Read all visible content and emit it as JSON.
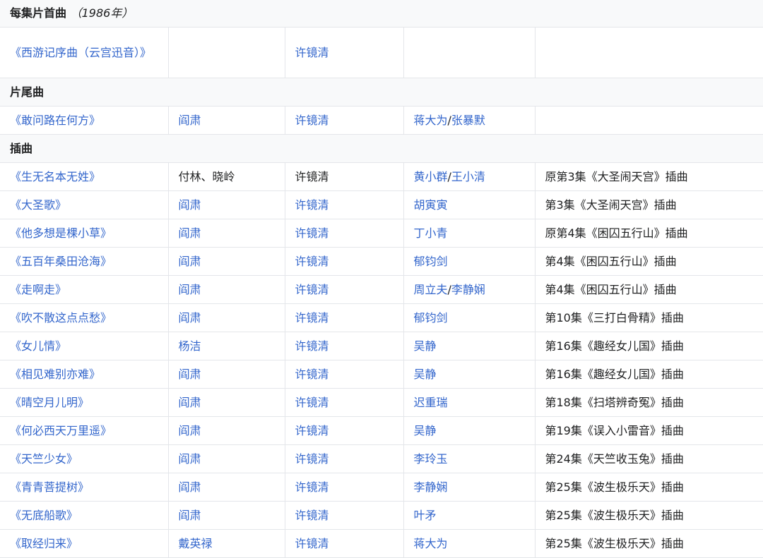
{
  "sections": {
    "opening": {
      "label": "每集片首曲",
      "year": "（1986年）"
    },
    "ending": {
      "label": "片尾曲"
    },
    "insert": {
      "label": "插曲"
    }
  },
  "opening_row": {
    "title": "《西游记序曲（云宫迅音）》",
    "composer": "许镜清"
  },
  "ending_row": {
    "title": "《敢问路在何方》",
    "lyricist": "阎肃",
    "composer": "许镜清",
    "singer_a": "蒋大为",
    "singer_b": "张暴默"
  },
  "rows": [
    {
      "title": "《生无名本无姓》",
      "lyricist": "付林、晓岭",
      "composer": "许镜清",
      "singer_a": "黄小群",
      "singer_b": "王小清",
      "note": "原第3集《大圣闹天宫》插曲"
    },
    {
      "title": "《大圣歌》",
      "lyricist": "阎肃",
      "composer": "许镜清",
      "singer_a": "胡寅寅",
      "singer_b": "",
      "note": "第3集《大圣闹天宫》插曲"
    },
    {
      "title": "《他多想是棵小草》",
      "lyricist": "阎肃",
      "composer": "许镜清",
      "singer_a": "丁小青",
      "singer_b": "",
      "note": "原第4集《困囚五行山》插曲"
    },
    {
      "title": "《五百年桑田沧海》",
      "lyricist": "阎肃",
      "composer": "许镜清",
      "singer_a": "郁钧剑",
      "singer_b": "",
      "note": "第4集《困囚五行山》插曲"
    },
    {
      "title": "《走啊走》",
      "lyricist": "阎肃",
      "composer": "许镜清",
      "singer_a": "周立夫",
      "singer_b": "李静娴",
      "note": "第4集《困囚五行山》插曲"
    },
    {
      "title": "《吹不散这点点愁》",
      "lyricist": "阎肃",
      "composer": "许镜清",
      "singer_a": "郁钧剑",
      "singer_b": "",
      "note": "第10集《三打白骨精》插曲"
    },
    {
      "title": "《女儿情》",
      "lyricist": "杨洁",
      "composer": "许镜清",
      "singer_a": "吴静",
      "singer_b": "",
      "note": "第16集《趣经女儿国》插曲"
    },
    {
      "title": "《相见难别亦难》",
      "lyricist": "阎肃",
      "composer": "许镜清",
      "singer_a": "吴静",
      "singer_b": "",
      "note": "第16集《趣经女儿国》插曲"
    },
    {
      "title": "《晴空月儿明》",
      "lyricist": "阎肃",
      "composer": "许镜清",
      "singer_a": "迟重瑞",
      "singer_b": "",
      "note": "第18集《扫塔辨奇冤》插曲"
    },
    {
      "title": "《何必西天万里遥》",
      "lyricist": "阎肃",
      "composer": "许镜清",
      "singer_a": "吴静",
      "singer_b": "",
      "note": "第19集《误入小雷音》插曲"
    },
    {
      "title": "《天竺少女》",
      "lyricist": "阎肃",
      "composer": "许镜清",
      "singer_a": "李玲玉",
      "singer_b": "",
      "note": "第24集《天竺收玉兔》插曲"
    },
    {
      "title": "《青青菩提树》",
      "lyricist": "阎肃",
      "composer": "许镜清",
      "singer_a": "李静娴",
      "singer_b": "",
      "note": "第25集《波生极乐天》插曲"
    },
    {
      "title": "《无底船歌》",
      "lyricist": "阎肃",
      "composer": "许镜清",
      "singer_a": "叶矛",
      "singer_b": "",
      "note": "第25集《波生极乐天》插曲"
    },
    {
      "title": "《取经归来》",
      "lyricist": "戴英禄",
      "composer": "许镜清",
      "singer_a": "蒋大为",
      "singer_b": "",
      "note": "第25集《波生极乐天》插曲"
    }
  ]
}
